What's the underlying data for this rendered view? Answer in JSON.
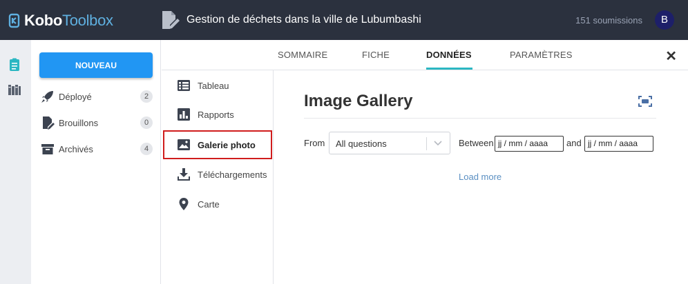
{
  "brand": {
    "name_bold": "Kobo",
    "name_light": "Toolbox",
    "accent": "#5fb0e0"
  },
  "header": {
    "form_title": "Gestion de déchets dans la ville de Lubumbashi",
    "submissions": "151 soumissions",
    "avatar_initial": "B"
  },
  "rail": {
    "icons": [
      "forms-icon",
      "library-icon"
    ]
  },
  "sidebar": {
    "new_button": "NOUVEAU",
    "items": [
      {
        "label": "Déployé",
        "count": "2",
        "icon": "rocket-icon"
      },
      {
        "label": "Brouillons",
        "count": "0",
        "icon": "draft-icon"
      },
      {
        "label": "Archivés",
        "count": "4",
        "icon": "archive-icon"
      }
    ]
  },
  "tabs": [
    {
      "label": "SOMMAIRE",
      "active": false
    },
    {
      "label": "FICHE",
      "active": false
    },
    {
      "label": "DONNÉES",
      "active": true
    },
    {
      "label": "PARAMÈTRES",
      "active": false
    }
  ],
  "close_label": "✕",
  "subnav": [
    {
      "label": "Tableau",
      "icon": "table-icon",
      "active": false
    },
    {
      "label": "Rapports",
      "icon": "reports-icon",
      "active": false
    },
    {
      "label": "Galerie photo",
      "icon": "gallery-icon",
      "active": true
    },
    {
      "label": "Téléchargements",
      "icon": "download-icon",
      "active": false
    },
    {
      "label": "Carte",
      "icon": "map-pin-icon",
      "active": false
    }
  ],
  "gallery": {
    "title": "Image Gallery",
    "from_label": "From",
    "question_select": "All questions",
    "between_label": "Between",
    "date_start_placeholder": "jj / mm / aaaa",
    "and_label": "and",
    "date_end_placeholder": "jj / mm / aaaa",
    "load_more": "Load more"
  },
  "colors": {
    "topbar": "#2b313e",
    "primary": "#2196f3",
    "tab_underline": "#2bb7c2",
    "highlight": "#d01c1c"
  }
}
